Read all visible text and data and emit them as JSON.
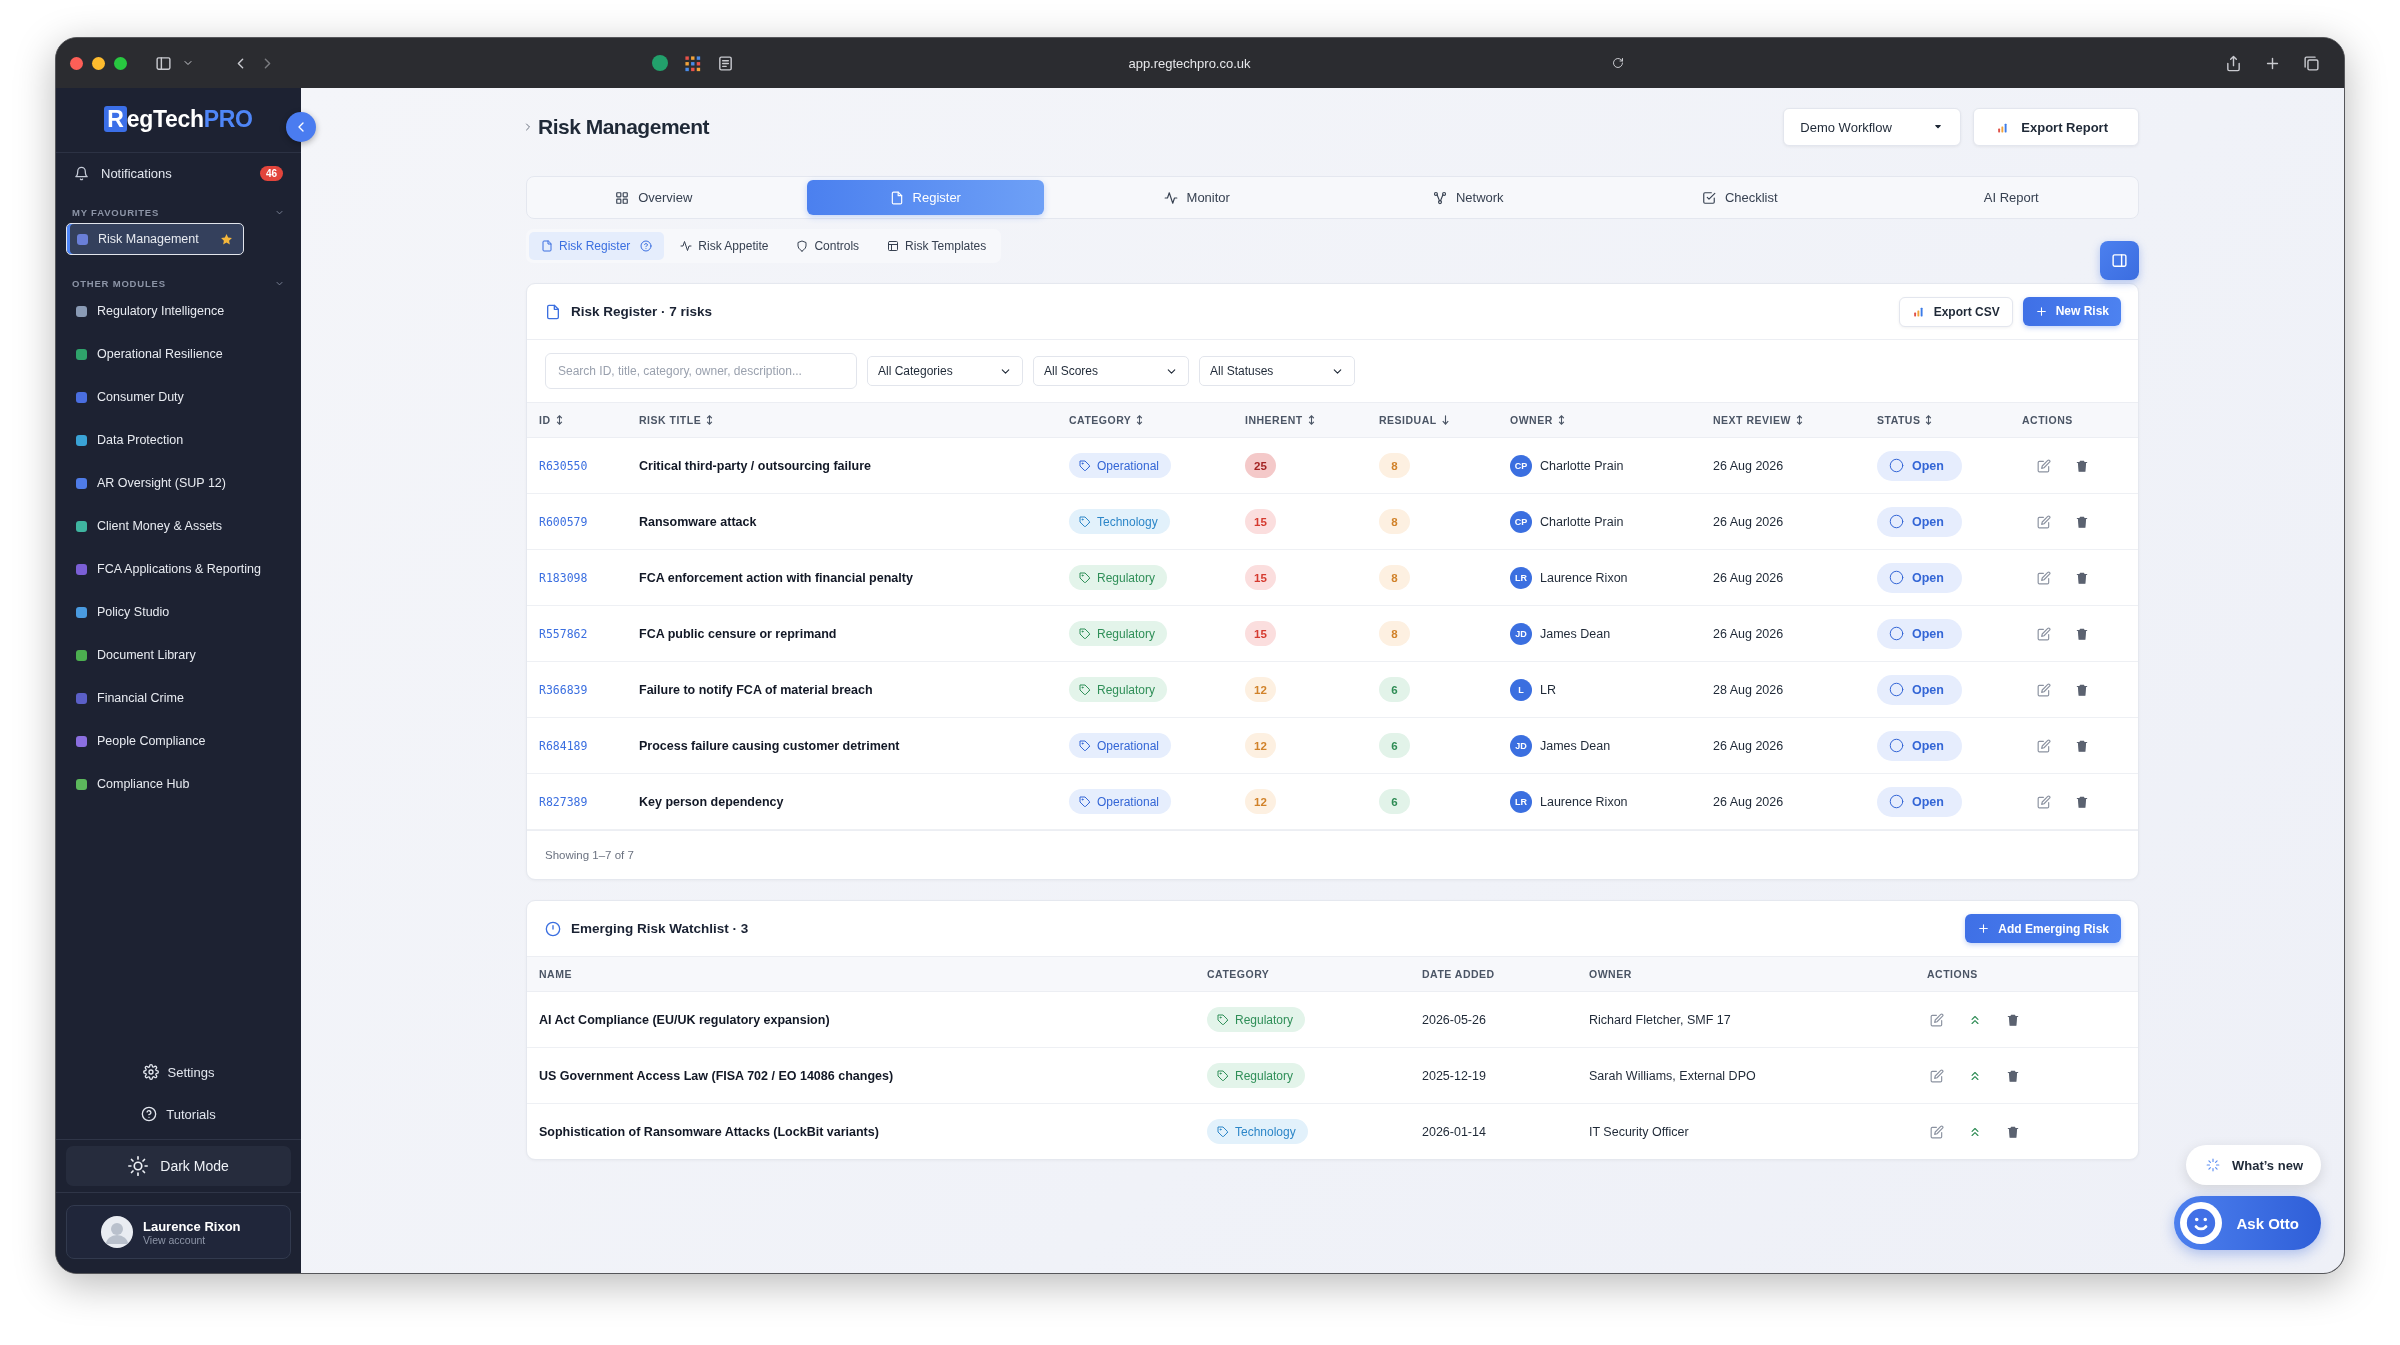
{
  "browser": {
    "url": "app.regtechpro.co.uk"
  },
  "sidebar": {
    "logo": {
      "mark": "R",
      "name": "egTech",
      "suffix": "PRO"
    },
    "notifications": {
      "label": "Notifications",
      "count": "46"
    },
    "sections": [
      {
        "title": "MY FAVOURITES",
        "expanded": true,
        "items": [
          {
            "label": "Risk Management",
            "selected": true,
            "starred": true,
            "color": "#6a7fd8"
          }
        ]
      },
      {
        "title": "OTHER MODULES",
        "expanded": true,
        "items": [
          {
            "label": "Regulatory Intelligence",
            "selected": false,
            "starred": false,
            "color": "#8a9bb5"
          },
          {
            "label": "Operational Resilience",
            "selected": false,
            "starred": false,
            "color": "#2fa36b"
          },
          {
            "label": "Consumer Duty",
            "selected": false,
            "starred": false,
            "color": "#4a6ee0"
          },
          {
            "label": "Data Protection",
            "selected": false,
            "starred": false,
            "color": "#3aa3d6"
          },
          {
            "label": "AR Oversight (SUP 12)",
            "selected": false,
            "starred": false,
            "color": "#4f7ce8"
          },
          {
            "label": "Client Money & Assets",
            "selected": false,
            "starred": false,
            "color": "#3fb5a0"
          },
          {
            "label": "FCA Applications & Reporting",
            "selected": false,
            "starred": false,
            "color": "#7b5fd6"
          },
          {
            "label": "Policy Studio",
            "selected": false,
            "starred": false,
            "color": "#4a9be0"
          },
          {
            "label": "Document Library",
            "selected": false,
            "starred": false,
            "color": "#4caf50"
          },
          {
            "label": "Financial Crime",
            "selected": false,
            "starred": false,
            "color": "#5b5fc7"
          },
          {
            "label": "People Compliance",
            "selected": false,
            "starred": false,
            "color": "#8b6fe0"
          },
          {
            "label": "Compliance Hub",
            "selected": false,
            "starred": false,
            "color": "#5cb85c"
          }
        ]
      }
    ],
    "footer_links": [
      "Settings",
      "Tutorials"
    ],
    "dark_mode": "Dark Mode",
    "user": {
      "name": "Laurence Rixon",
      "subtitle": "View account"
    }
  },
  "header": {
    "title": "Risk Management",
    "workflow_select": {
      "value": "Demo Workflow"
    },
    "export_button": "Export Report"
  },
  "tabs": [
    {
      "label": "Overview",
      "selected": false
    },
    {
      "label": "Register",
      "selected": true
    },
    {
      "label": "Monitor",
      "selected": false
    },
    {
      "label": "Network",
      "selected": false
    },
    {
      "label": "Checklist",
      "selected": false
    },
    {
      "label": "AI Report",
      "selected": false
    }
  ],
  "subtabs": [
    {
      "label": "Risk Register",
      "selected": true
    },
    {
      "label": "Risk Appetite",
      "selected": false
    },
    {
      "label": "Controls",
      "selected": false
    },
    {
      "label": "Risk Templates",
      "selected": false
    }
  ],
  "register": {
    "title": "Risk Register · 7 risks",
    "export_button": "Export CSV",
    "new_button": "New Risk",
    "search": {
      "placeholder": "Search ID, title, category, owner, description..."
    },
    "filters": [
      {
        "value": "All Categories"
      },
      {
        "value": "All Scores"
      },
      {
        "value": "All Statuses"
      }
    ],
    "columns": [
      {
        "label": "ID",
        "kind": "sortable"
      },
      {
        "label": "RISK TITLE",
        "kind": "sortable"
      },
      {
        "label": "CATEGORY",
        "kind": "sortable"
      },
      {
        "label": "INHERENT",
        "kind": "sortable"
      },
      {
        "label": "RESIDUAL",
        "kind": "sorted"
      },
      {
        "label": "OWNER",
        "kind": "sortable"
      },
      {
        "label": "NEXT REVIEW",
        "kind": "sortable"
      },
      {
        "label": "STATUS",
        "kind": "sortable"
      },
      {
        "label": "ACTIONS",
        "kind": "plain"
      }
    ],
    "rows": [
      {
        "id": "R630550",
        "title": "Critical third-party / outsourcing failure",
        "category": {
          "label": "Operational",
          "kind": "operational"
        },
        "inherent": {
          "value": "25",
          "kind": "critical"
        },
        "residual": {
          "value": "8",
          "kind": "medium"
        },
        "owner": {
          "initials": "CP",
          "name": "Charlotte Prain"
        },
        "next_review": "26 Aug 2026",
        "status": "Open"
      },
      {
        "id": "R600579",
        "title": "Ransomware attack",
        "category": {
          "label": "Technology",
          "kind": "technology"
        },
        "inherent": {
          "value": "15",
          "kind": "high"
        },
        "residual": {
          "value": "8",
          "kind": "medium"
        },
        "owner": {
          "initials": "CP",
          "name": "Charlotte Prain"
        },
        "next_review": "26 Aug 2026",
        "status": "Open"
      },
      {
        "id": "R183098",
        "title": "FCA enforcement action with financial penalty",
        "category": {
          "label": "Regulatory",
          "kind": "regulatory"
        },
        "inherent": {
          "value": "15",
          "kind": "high"
        },
        "residual": {
          "value": "8",
          "kind": "medium"
        },
        "owner": {
          "initials": "LR",
          "name": "Laurence Rixon"
        },
        "next_review": "26 Aug 2026",
        "status": "Open"
      },
      {
        "id": "R557862",
        "title": "FCA public censure or reprimand",
        "category": {
          "label": "Regulatory",
          "kind": "regulatory"
        },
        "inherent": {
          "value": "15",
          "kind": "high"
        },
        "residual": {
          "value": "8",
          "kind": "medium"
        },
        "owner": {
          "initials": "JD",
          "name": "James Dean"
        },
        "next_review": "26 Aug 2026",
        "status": "Open"
      },
      {
        "id": "R366839",
        "title": "Failure to notify FCA of material breach",
        "category": {
          "label": "Regulatory",
          "kind": "regulatory"
        },
        "inherent": {
          "value": "12",
          "kind": "medium"
        },
        "residual": {
          "value": "6",
          "kind": "low"
        },
        "owner": {
          "initials": "L",
          "name": "LR"
        },
        "next_review": "28 Aug 2026",
        "status": "Open"
      },
      {
        "id": "R684189",
        "title": "Process failure causing customer detriment",
        "category": {
          "label": "Operational",
          "kind": "operational"
        },
        "inherent": {
          "value": "12",
          "kind": "medium"
        },
        "residual": {
          "value": "6",
          "kind": "low"
        },
        "owner": {
          "initials": "JD",
          "name": "James Dean"
        },
        "next_review": "26 Aug 2026",
        "status": "Open"
      },
      {
        "id": "R827389",
        "title": "Key person dependency",
        "category": {
          "label": "Operational",
          "kind": "operational"
        },
        "inherent": {
          "value": "12",
          "kind": "medium"
        },
        "residual": {
          "value": "6",
          "kind": "low"
        },
        "owner": {
          "initials": "LR",
          "name": "Laurence Rixon"
        },
        "next_review": "26 Aug 2026",
        "status": "Open"
      }
    ],
    "footer": "Showing 1–7 of 7"
  },
  "watchlist": {
    "title": "Emerging Risk Watchlist · 3",
    "add_button": "Add Emerging Risk",
    "columns": [
      "NAME",
      "CATEGORY",
      "DATE ADDED",
      "OWNER",
      "ACTIONS"
    ],
    "rows": [
      {
        "name": "AI Act Compliance (EU/UK regulatory expansion)",
        "category": {
          "label": "Regulatory",
          "kind": "regulatory"
        },
        "date_added": "2026-05-26",
        "owner": "Richard Fletcher, SMF 17"
      },
      {
        "name": "US Government Access Law (FISA 702 / EO 14086 changes)",
        "category": {
          "label": "Regulatory",
          "kind": "regulatory"
        },
        "date_added": "2025-12-19",
        "owner": "Sarah Williams, External DPO"
      },
      {
        "name": "Sophistication of Ransomware Attacks (LockBit variants)",
        "category": {
          "label": "Technology",
          "kind": "technology"
        },
        "date_added": "2026-01-14",
        "owner": "IT Security Officer"
      }
    ]
  },
  "floating": {
    "whats_new": "What’s new",
    "assistant": "Ask Otto"
  }
}
